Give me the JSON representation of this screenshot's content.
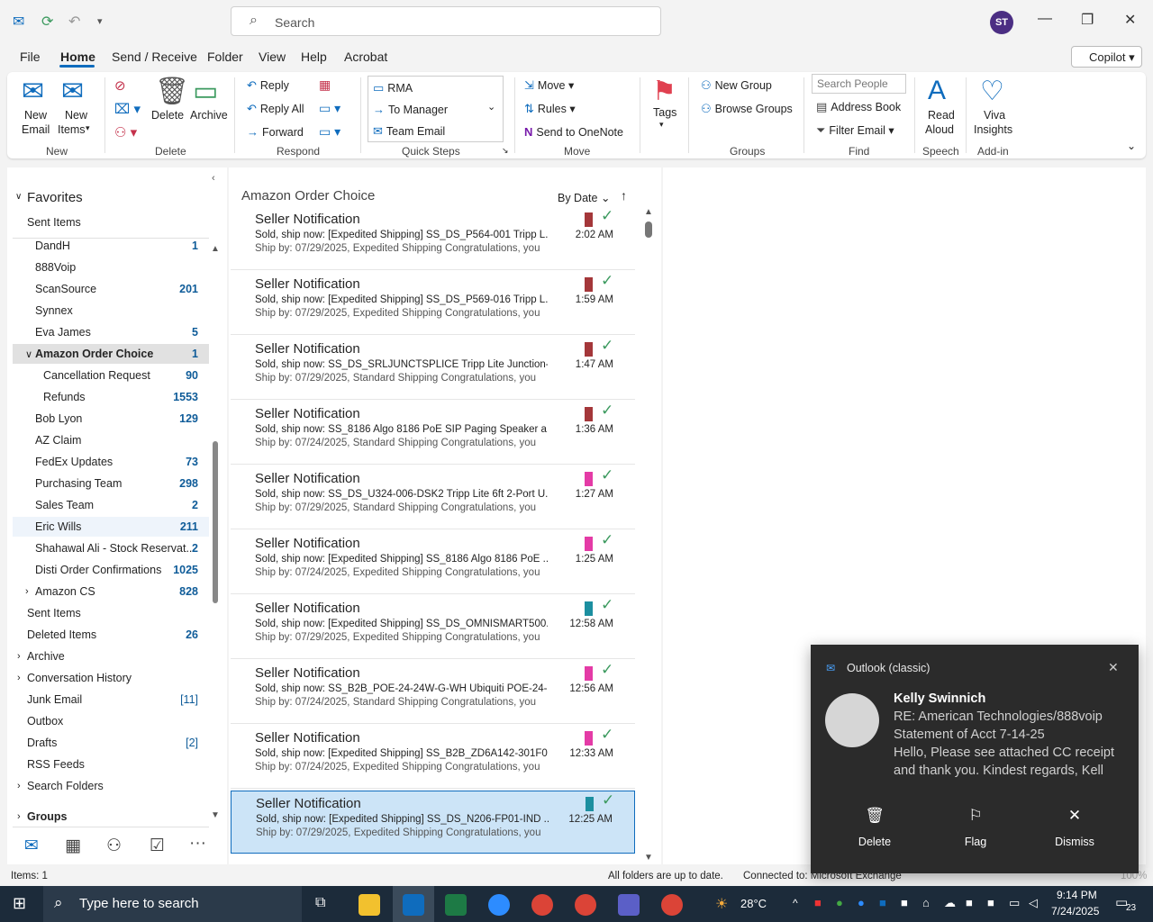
{
  "titlebar": {
    "search_placeholder": "Search",
    "avatar_initials": "ST",
    "minimize": "—",
    "maximize": "❐",
    "close": "✕"
  },
  "menu": {
    "items": [
      "File",
      "Home",
      "Send / Receive",
      "Folder",
      "View",
      "Help",
      "Acrobat"
    ],
    "copilot": "Copilot"
  },
  "ribbon": {
    "new_email": "New",
    "new_email2": "Email",
    "new_items": "New",
    "new_items2": "Items",
    "delete": "Delete",
    "archive": "Archive",
    "reply": "Reply",
    "reply_all": "Reply All",
    "forward": "Forward",
    "quick_steps": [
      "RMA",
      "To Manager",
      "Team Email"
    ],
    "move": "Move",
    "rules": "Rules",
    "send_onenote": "Send to OneNote",
    "tags": "Tags",
    "new_group": "New Group",
    "browse_groups": "Browse Groups",
    "search_people": "Search People",
    "address_book": "Address Book",
    "filter_email": "Filter Email",
    "read_aloud": "Read",
    "read_aloud2": "Aloud",
    "viva": "Viva",
    "viva2": "Insights",
    "groups_labels": [
      "New",
      "Delete",
      "Respond",
      "Quick Steps",
      "Move",
      "Groups",
      "Find",
      "Speech",
      "Add-in"
    ]
  },
  "nav": {
    "favorites": "Favorites",
    "fav_sent": "Sent Items",
    "folders": [
      {
        "label": "DandH",
        "count": "1"
      },
      {
        "label": "888Voip",
        "count": ""
      },
      {
        "label": "ScanSource",
        "count": "201"
      },
      {
        "label": "Synnex",
        "count": ""
      },
      {
        "label": "Eva James",
        "count": "5"
      },
      {
        "label": "Amazon Order Choice",
        "count": "1"
      },
      {
        "label": "Cancellation Request",
        "count": "90"
      },
      {
        "label": "Refunds",
        "count": "1553"
      },
      {
        "label": "Bob Lyon",
        "count": "129"
      },
      {
        "label": "AZ Claim",
        "count": ""
      },
      {
        "label": "FedEx Updates",
        "count": "73"
      },
      {
        "label": "Purchasing Team",
        "count": "298"
      },
      {
        "label": "Sales Team",
        "count": "2"
      },
      {
        "label": "Eric Wills",
        "count": "211"
      },
      {
        "label": "Shahawal Ali - Stock Reservat...",
        "count": "2"
      },
      {
        "label": "Disti Order Confirmations",
        "count": "1025"
      },
      {
        "label": "Amazon CS",
        "count": "828"
      },
      {
        "label": "Sent Items",
        "count": ""
      },
      {
        "label": "Deleted Items",
        "count": "26"
      },
      {
        "label": "Archive",
        "count": ""
      },
      {
        "label": "Conversation History",
        "count": ""
      },
      {
        "label": "Junk Email",
        "count": "[11]"
      },
      {
        "label": "Outbox",
        "count": ""
      },
      {
        "label": "Drafts",
        "count": "[2]"
      },
      {
        "label": "RSS Feeds",
        "count": ""
      },
      {
        "label": "Search Folders",
        "count": ""
      },
      {
        "label": "Groups",
        "count": ""
      }
    ]
  },
  "list": {
    "title": "Amazon Order Choice",
    "sort": "By Date",
    "messages": [
      {
        "from": "Seller Notification",
        "subject": "Sold, ship now: [Expedited Shipping] SS_DS_P564-001 Tripp L...",
        "preview": "Ship by: 07/29/2025, Expedited Shipping  Congratulations, you",
        "time": "2:02 AM",
        "color": "#a4373a"
      },
      {
        "from": "Seller Notification",
        "subject": "Sold, ship now: [Expedited Shipping] SS_DS_P569-016 Tripp L...",
        "preview": "Ship by: 07/29/2025, Expedited Shipping  Congratulations, you",
        "time": "1:59 AM",
        "color": "#a4373a"
      },
      {
        "from": "Seller Notification",
        "subject": "Sold, ship now: SS_DS_SRLJUNCTSPLICE Tripp Lite Junction-S...",
        "preview": "Ship by: 07/29/2025, Standard Shipping  Congratulations, you",
        "time": "1:47 AM",
        "color": "#a4373a"
      },
      {
        "from": "Seller Notification",
        "subject": "Sold, ship now: SS_8186 Algo 8186 PoE SIP Paging Speaker a...",
        "preview": "Ship by: 07/24/2025, Standard Shipping  Congratulations, you",
        "time": "1:36 AM",
        "color": "#a4373a"
      },
      {
        "from": "Seller Notification",
        "subject": "Sold, ship now: SS_DS_U324-006-DSK2 Tripp Lite 6ft 2-Port U...",
        "preview": "Ship by: 07/29/2025, Standard Shipping  Congratulations, you",
        "time": "1:27 AM",
        "color": "#e43ba6"
      },
      {
        "from": "Seller Notification",
        "subject": "Sold, ship now: [Expedited Shipping] SS_8186 Algo 8186 PoE ...",
        "preview": "Ship by: 07/24/2025, Expedited Shipping  Congratulations, you",
        "time": "1:25 AM",
        "color": "#e43ba6"
      },
      {
        "from": "Seller Notification",
        "subject": "Sold, ship now: [Expedited Shipping] SS_DS_OMNISMART500...",
        "preview": "Ship by: 07/29/2025, Expedited Shipping  Congratulations, you",
        "time": "12:58 AM",
        "color": "#1c8fa0"
      },
      {
        "from": "Seller Notification",
        "subject": "Sold, ship now: SS_B2B_POE-24-24W-G-WH Ubiquiti POE-24-...",
        "preview": "Ship by: 07/24/2025, Standard Shipping  Congratulations, you",
        "time": "12:56 AM",
        "color": "#e43ba6"
      },
      {
        "from": "Seller Notification",
        "subject": "Sold, ship now: [Expedited Shipping] SS_B2B_ZD6A142-301F0...",
        "preview": "Ship by: 07/24/2025, Expedited Shipping  Congratulations, you",
        "time": "12:33 AM",
        "color": "#e43ba6"
      },
      {
        "from": "Seller Notification",
        "subject": "Sold, ship now: [Expedited Shipping] SS_DS_N206-FP01-IND ...",
        "preview": "Ship by: 07/29/2025, Expedited Shipping  Congratulations, you",
        "time": "12:25 AM",
        "color": "#1c8fa0"
      }
    ]
  },
  "status": {
    "items": "Items: 1",
    "sync": "All folders are up to date.",
    "connected": "Connected to: Microsoft Exchange",
    "zoom": "100%"
  },
  "toast": {
    "app": "Outlook (classic)",
    "sender": "Kelly Swinnich",
    "line1": "RE: American Technologies/888voip",
    "line2": "Statement of Acct 7-14-25",
    "line3": "Hello,  Please see attached CC receipt",
    "line4": "and thank you.  Kindest regards,     Kell",
    "actions": [
      "Delete",
      "Flag",
      "Dismiss"
    ]
  },
  "taskbar": {
    "search": "Type here to search",
    "weather": "28°C",
    "time": "9:14 PM",
    "date": "7/24/2025",
    "notif": "23"
  }
}
